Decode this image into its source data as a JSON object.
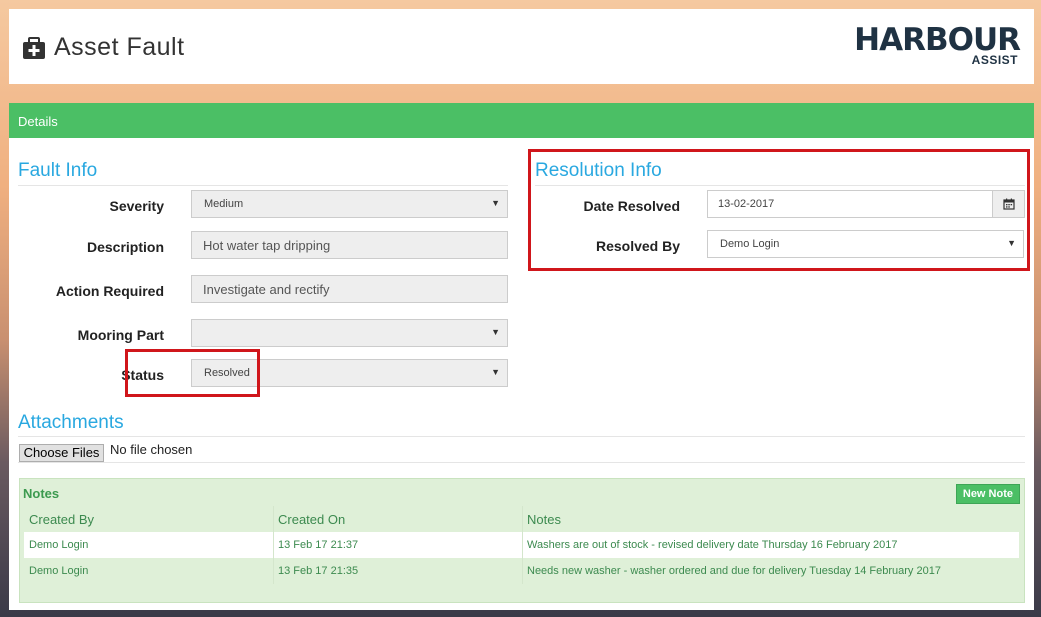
{
  "header": {
    "title": "Asset Fault",
    "page_icon": "medkit-icon"
  },
  "logo": {
    "word": "HARBOUR",
    "sub": "ASSIST"
  },
  "panel": {
    "heading": "Details"
  },
  "fault_info": {
    "title": "Fault Info",
    "severity": {
      "label": "Severity",
      "value": "Medium"
    },
    "description": {
      "label": "Description",
      "value": "Hot water tap dripping"
    },
    "action_required": {
      "label": "Action Required",
      "value": "Investigate and rectify"
    },
    "mooring_part": {
      "label": "Mooring Part",
      "value": ""
    },
    "status": {
      "label": "Status",
      "value": "Resolved"
    }
  },
  "resolution_info": {
    "title": "Resolution Info",
    "date_resolved": {
      "label": "Date Resolved",
      "value": "13-02-2017",
      "icon": "calendar-icon"
    },
    "resolved_by": {
      "label": "Resolved By",
      "value": "Demo Login"
    }
  },
  "attachments": {
    "title": "Attachments",
    "choose_label": "Choose Files",
    "file_status": "No file chosen"
  },
  "notes": {
    "title": "Notes",
    "new_button": "New Note",
    "columns": [
      "Created By",
      "Created On",
      "Notes"
    ],
    "rows": [
      [
        "Demo Login",
        "13 Feb 17 21:37",
        "Washers are out of stock - revised delivery date Thursday 16 February 2017"
      ],
      [
        "Demo Login",
        "13 Feb 17 21:35",
        "Needs new washer - washer ordered and due for delivery Tuesday 14 February 2017"
      ]
    ]
  },
  "colors": {
    "accent_green": "#4bbf65",
    "title_blue": "#29a8e0",
    "highlight_red": "#d0161b"
  }
}
